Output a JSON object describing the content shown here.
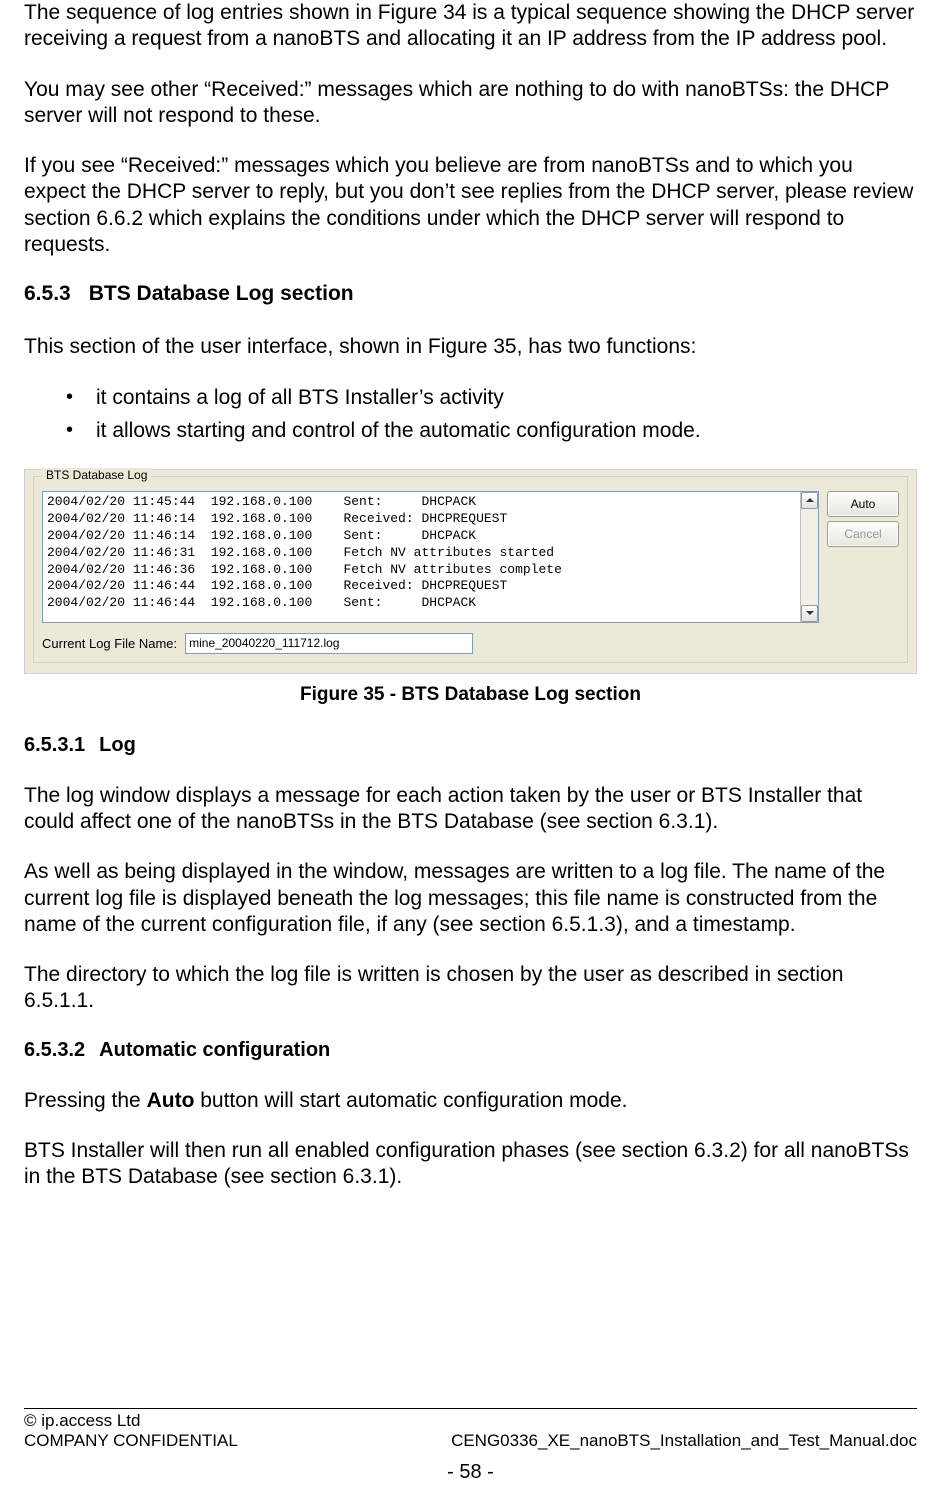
{
  "para1": "The sequence of log entries shown in Figure 34 is a typical sequence showing the DHCP server receiving a request from a nanoBTS and allocating it an IP address from the IP address pool.",
  "para2": "You may see other “Received:” messages which are nothing to do with nanoBTSs: the DHCP server will not respond to these.",
  "para3": "If you see “Received:” messages which you believe are from nanoBTSs and to which you expect the DHCP server to reply, but you don’t see replies from the DHCP server, please review section 6.6.2 which explains the conditions under which the DHCP server will respond to requests.",
  "h653_num": "6.5.3",
  "h653_title": "BTS Database Log section",
  "para4": "This section of the user interface, shown in Figure 35, has two functions:",
  "bullets": [
    "it contains a log of all BTS Installer’s activity",
    "it allows starting and control of the automatic configuration mode."
  ],
  "figure": {
    "group_label": "BTS Database Log",
    "log_lines": "2004/02/20 11:45:44  192.168.0.100    Sent:     DHCPACK\n2004/02/20 11:46:14  192.168.0.100    Received: DHCPREQUEST\n2004/02/20 11:46:14  192.168.0.100    Sent:     DHCPACK\n2004/02/20 11:46:31  192.168.0.100    Fetch NV attributes started\n2004/02/20 11:46:36  192.168.0.100    Fetch NV attributes complete\n2004/02/20 11:46:44  192.168.0.100    Received: DHCPREQUEST\n2004/02/20 11:46:44  192.168.0.100    Sent:     DHCPACK",
    "auto_btn": "Auto",
    "cancel_btn": "Cancel",
    "logfile_label": "Current Log File Name:",
    "logfile_value": "mine_20040220_111712.log",
    "caption": "Figure 35 - BTS Database Log section"
  },
  "h6531_num": "6.5.3.1",
  "h6531_title": "Log",
  "para5": "The log window displays a message for each action taken by the user or BTS Installer that could affect one of the nanoBTSs in the BTS Database (see section 6.3.1).",
  "para6": "As well as being displayed in the window, messages are written to a log file. The name of the current log file is displayed beneath the log messages; this file name is constructed from the name of the current configuration file, if any (see section 6.5.1.3), and a timestamp.",
  "para7": "The directory to which the log file is written is chosen by the user as described in section 6.5.1.1.",
  "h6532_num": "6.5.3.2",
  "h6532_title": "Automatic configuration",
  "para8a": "Pressing the ",
  "para8b": "Auto",
  "para8c": " button will start automatic configuration mode.",
  "para9": "BTS Installer will then run all enabled configuration phases (see section 6.3.2) for all nanoBTSs in the BTS Database (see section 6.3.1).",
  "footer": {
    "copyright": "© ip.access Ltd",
    "left": "COMPANY CONFIDENTIAL",
    "right": "CENG0336_XE_nanoBTS_Installation_and_Test_Manual.doc",
    "page": "- 58 -"
  }
}
